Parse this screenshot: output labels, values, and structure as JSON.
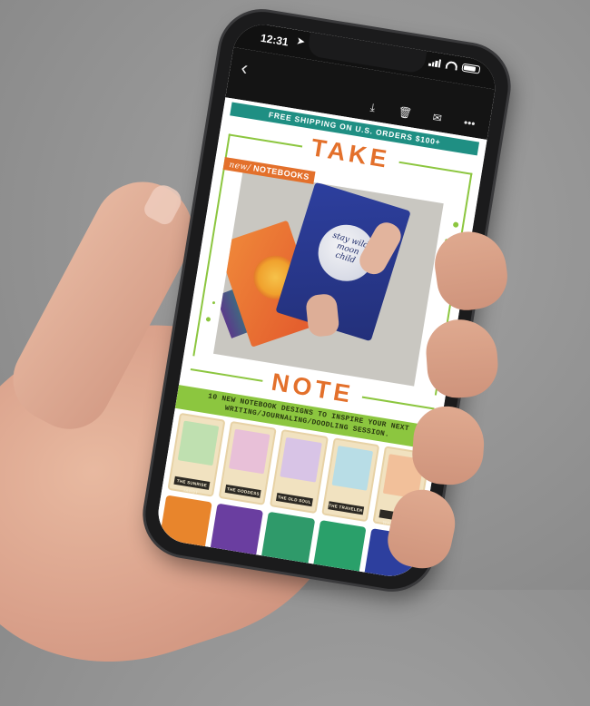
{
  "status_bar": {
    "time": "12:31",
    "location_icon": "location-arrow-icon"
  },
  "toolbar": {
    "back_icon": "chevron-left-icon",
    "icons": [
      "download-icon",
      "trash-icon",
      "mail-icon",
      "more-icon"
    ]
  },
  "email": {
    "banner": "FREE SHIPPING ON U.S. ORDERS $100+",
    "headline_top": "TAKE",
    "badge_new": "new/",
    "badge_label": "NOTEBOOKS",
    "moon_text": "stay wild moon child",
    "headline_bottom": "NOTE",
    "tagline": "10 NEW NOTEBOOK DESIGNS TO INSPIRE YOUR NEXT WRITING/JOURNALING/DOODLING SESSION.",
    "tarot_cards": [
      {
        "caption": "THE SUNRISE TAROT",
        "color": "#bfe0b0"
      },
      {
        "caption": "THE GODDESS",
        "color": "#e8c0d8"
      },
      {
        "caption": "THE OLD SOUL",
        "color": "#d8c4e6"
      },
      {
        "caption": "THE TRAVELER",
        "color": "#b8dde6"
      },
      {
        "caption": "THE WANDERER",
        "color": "#f2c09a"
      }
    ],
    "notebook_colors": [
      "#e8852c",
      "#6a3ea0",
      "#2f9a6a",
      "#2aa06a",
      "#2d3f9e"
    ]
  },
  "colors": {
    "banner": "#1f8f83",
    "accent_orange": "#e3702b",
    "accent_green": "#8cc63f"
  }
}
